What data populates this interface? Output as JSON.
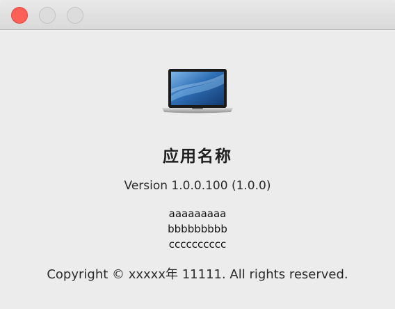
{
  "window": {
    "controls": {
      "close_color": "#fe5f57",
      "inactive_color": "#dcdcdc"
    }
  },
  "about": {
    "icon": "laptop-icon",
    "app_name": "应用名称",
    "version": "Version 1.0.0.100 (1.0.0)",
    "credits": [
      "aaaaaaaaa",
      "bbbbbbbbb",
      "cccccccccc"
    ],
    "copyright": "Copyright © xxxxx年 11111. All rights reserved."
  }
}
